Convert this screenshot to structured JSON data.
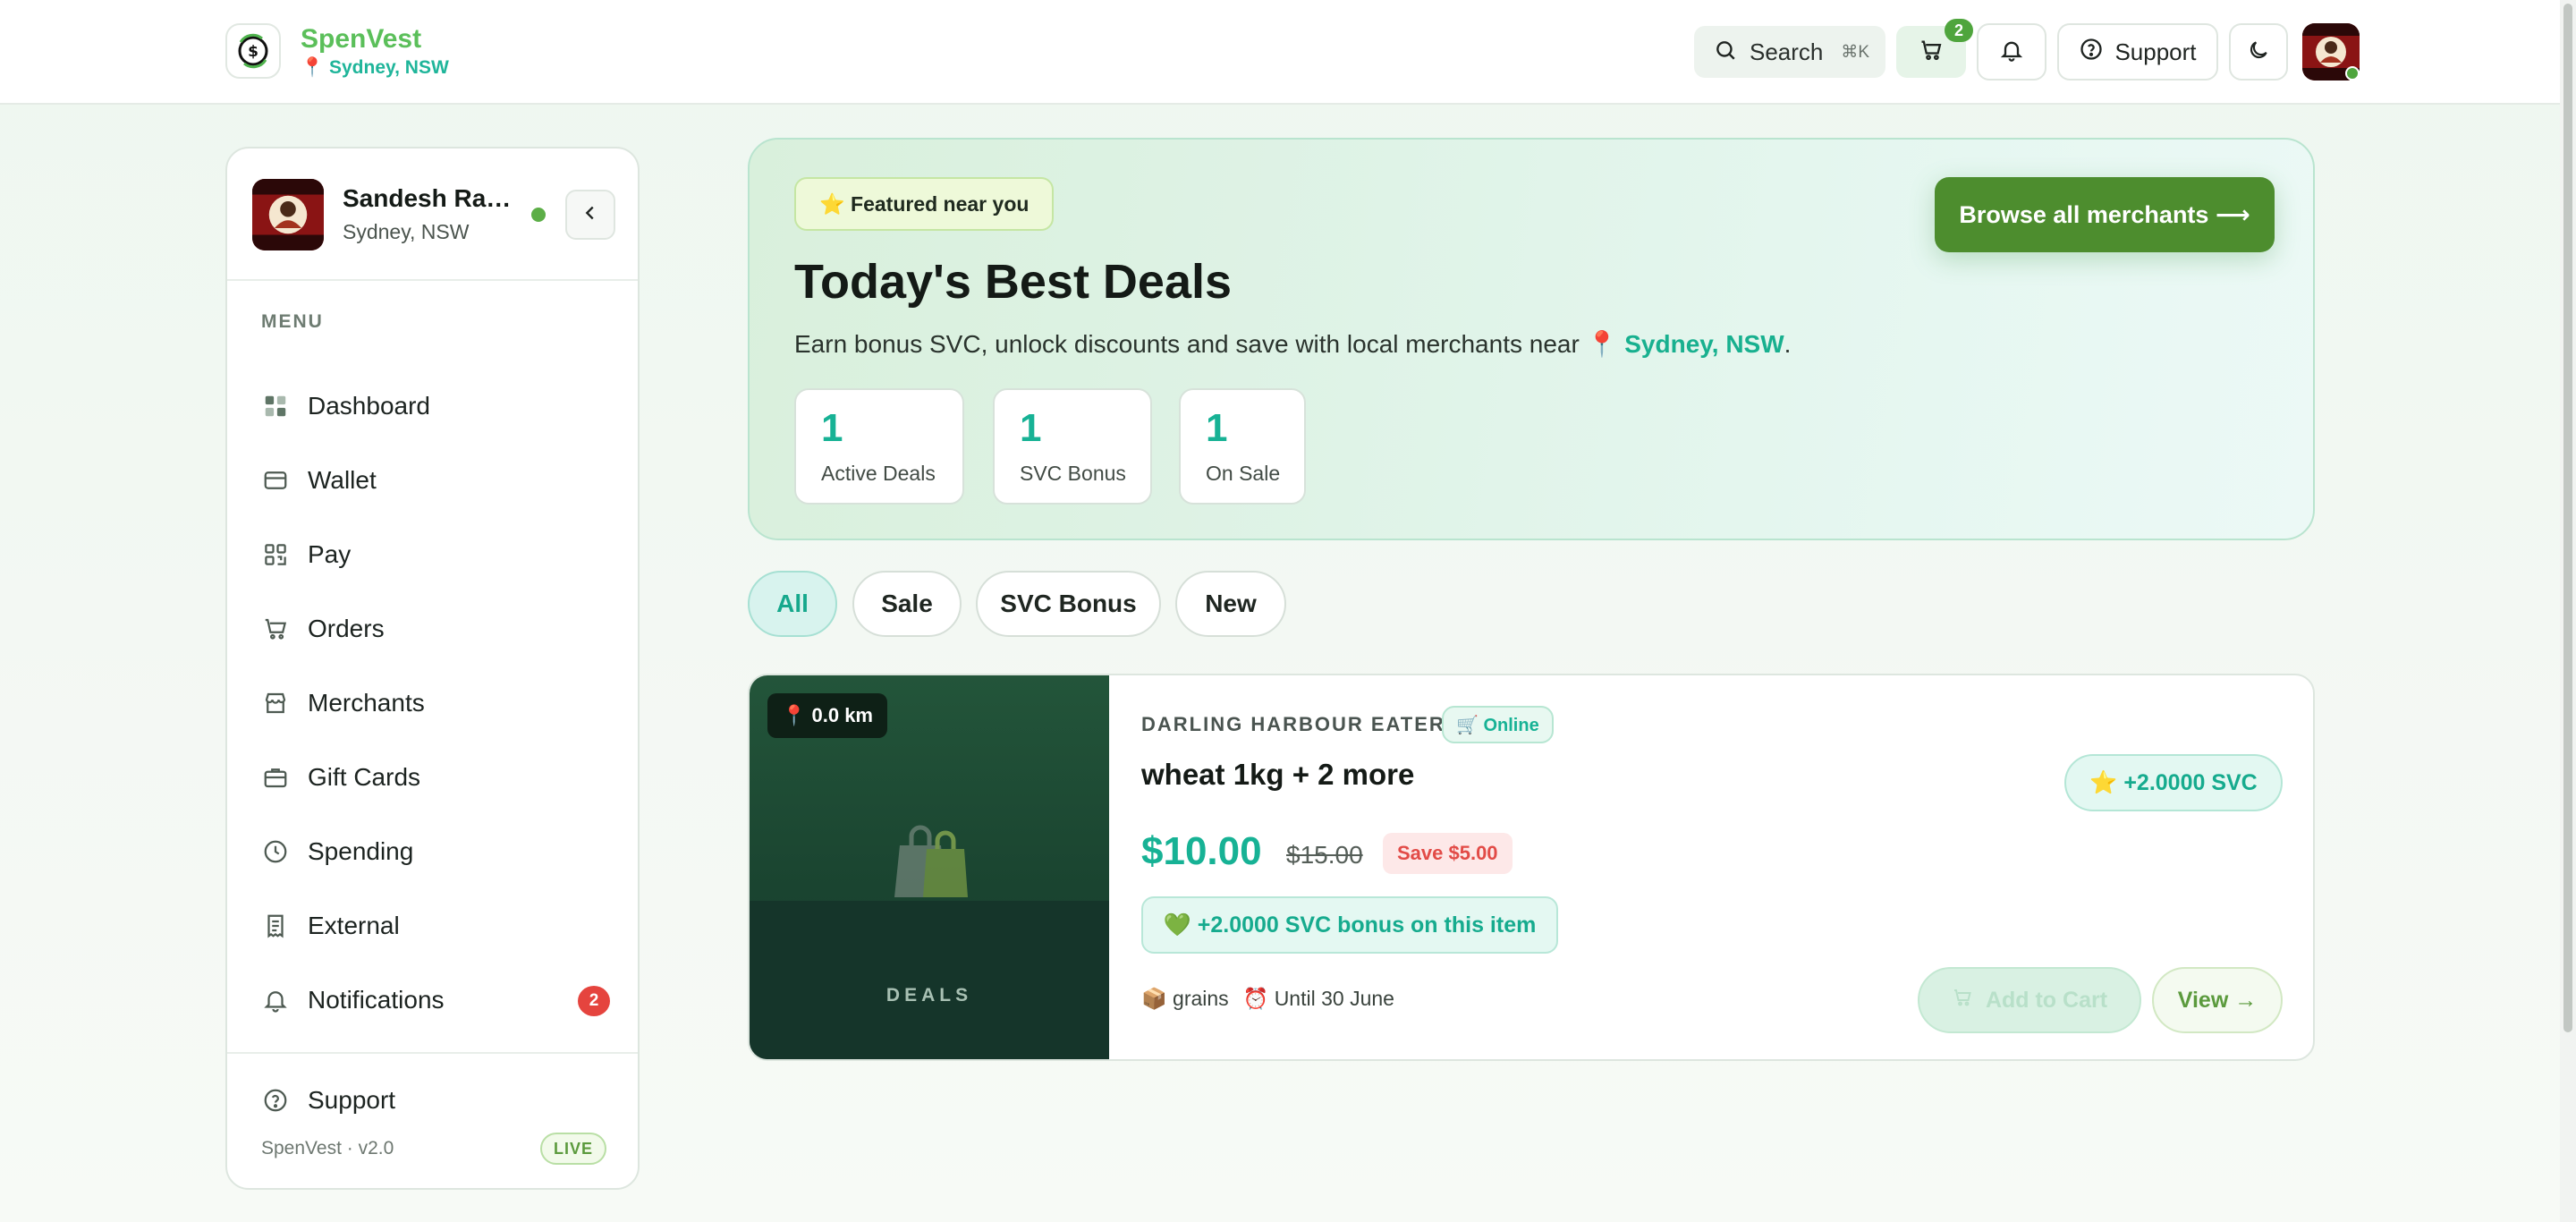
{
  "app": {
    "name": "SpenVest",
    "location": "📍 Sydney, NSW"
  },
  "topbar": {
    "search_label": "Search",
    "search_shortcut": "⌘K",
    "cart_count": "2",
    "support_label": "Support"
  },
  "user": {
    "name": "Sandesh Ran...",
    "location": "Sydney, NSW"
  },
  "sidebar": {
    "menu_heading": "MENU",
    "items": [
      {
        "label": "Dashboard",
        "icon": "grid-icon"
      },
      {
        "label": "Wallet",
        "icon": "wallet-icon"
      },
      {
        "label": "Pay",
        "icon": "qr-icon"
      },
      {
        "label": "Orders",
        "icon": "cart-icon"
      },
      {
        "label": "Merchants",
        "icon": "store-icon"
      },
      {
        "label": "Gift Cards",
        "icon": "briefcase-icon"
      },
      {
        "label": "Spending",
        "icon": "clock-icon"
      },
      {
        "label": "External",
        "icon": "receipt-icon"
      },
      {
        "label": "Notifications",
        "icon": "bell-icon",
        "badge": "2"
      }
    ],
    "support_label": "Support",
    "version": "SpenVest · v2.0",
    "live_label": "LIVE"
  },
  "hero": {
    "chip": "⭐ Featured near you",
    "title": "Today's Best Deals",
    "subtitle_prefix": "Earn bonus SVC, unlock discounts and save with local merchants near 📍 ",
    "subtitle_city": "Sydney, NSW",
    "subtitle_suffix": ".",
    "browse_label": "Browse all merchants ⟶",
    "stats": [
      {
        "value": "1",
        "label": "Active Deals"
      },
      {
        "value": "1",
        "label": "SVC Bonus"
      },
      {
        "value": "1",
        "label": "On Sale"
      }
    ]
  },
  "filters": [
    {
      "label": "All",
      "active": true
    },
    {
      "label": "Sale",
      "active": false
    },
    {
      "label": "SVC Bonus",
      "active": false
    },
    {
      "label": "New",
      "active": false
    }
  ],
  "deal": {
    "distance": "📍 0.0 km",
    "image_caption": "DEALS",
    "merchant": "DARLING HARBOUR EATERY",
    "online_chip": "🛒 Online",
    "title": "wheat 1kg + 2 more",
    "svc_pill": "⭐ +2.0000 SVC",
    "price": "$10.00",
    "old_price": "$15.00",
    "save_label": "Save $5.00",
    "bonus_text": "💚 +2.0000 SVC bonus on this item",
    "category": "📦 grains",
    "until": "⏰ Until 30 June",
    "add_to_cart_label": "Add to Cart",
    "view_label": "View →"
  },
  "colors": {
    "brand_green": "#5bbf5a",
    "teal_accent": "#17b295",
    "button_green": "#4d8d2e",
    "alert_red": "#e5443e"
  }
}
